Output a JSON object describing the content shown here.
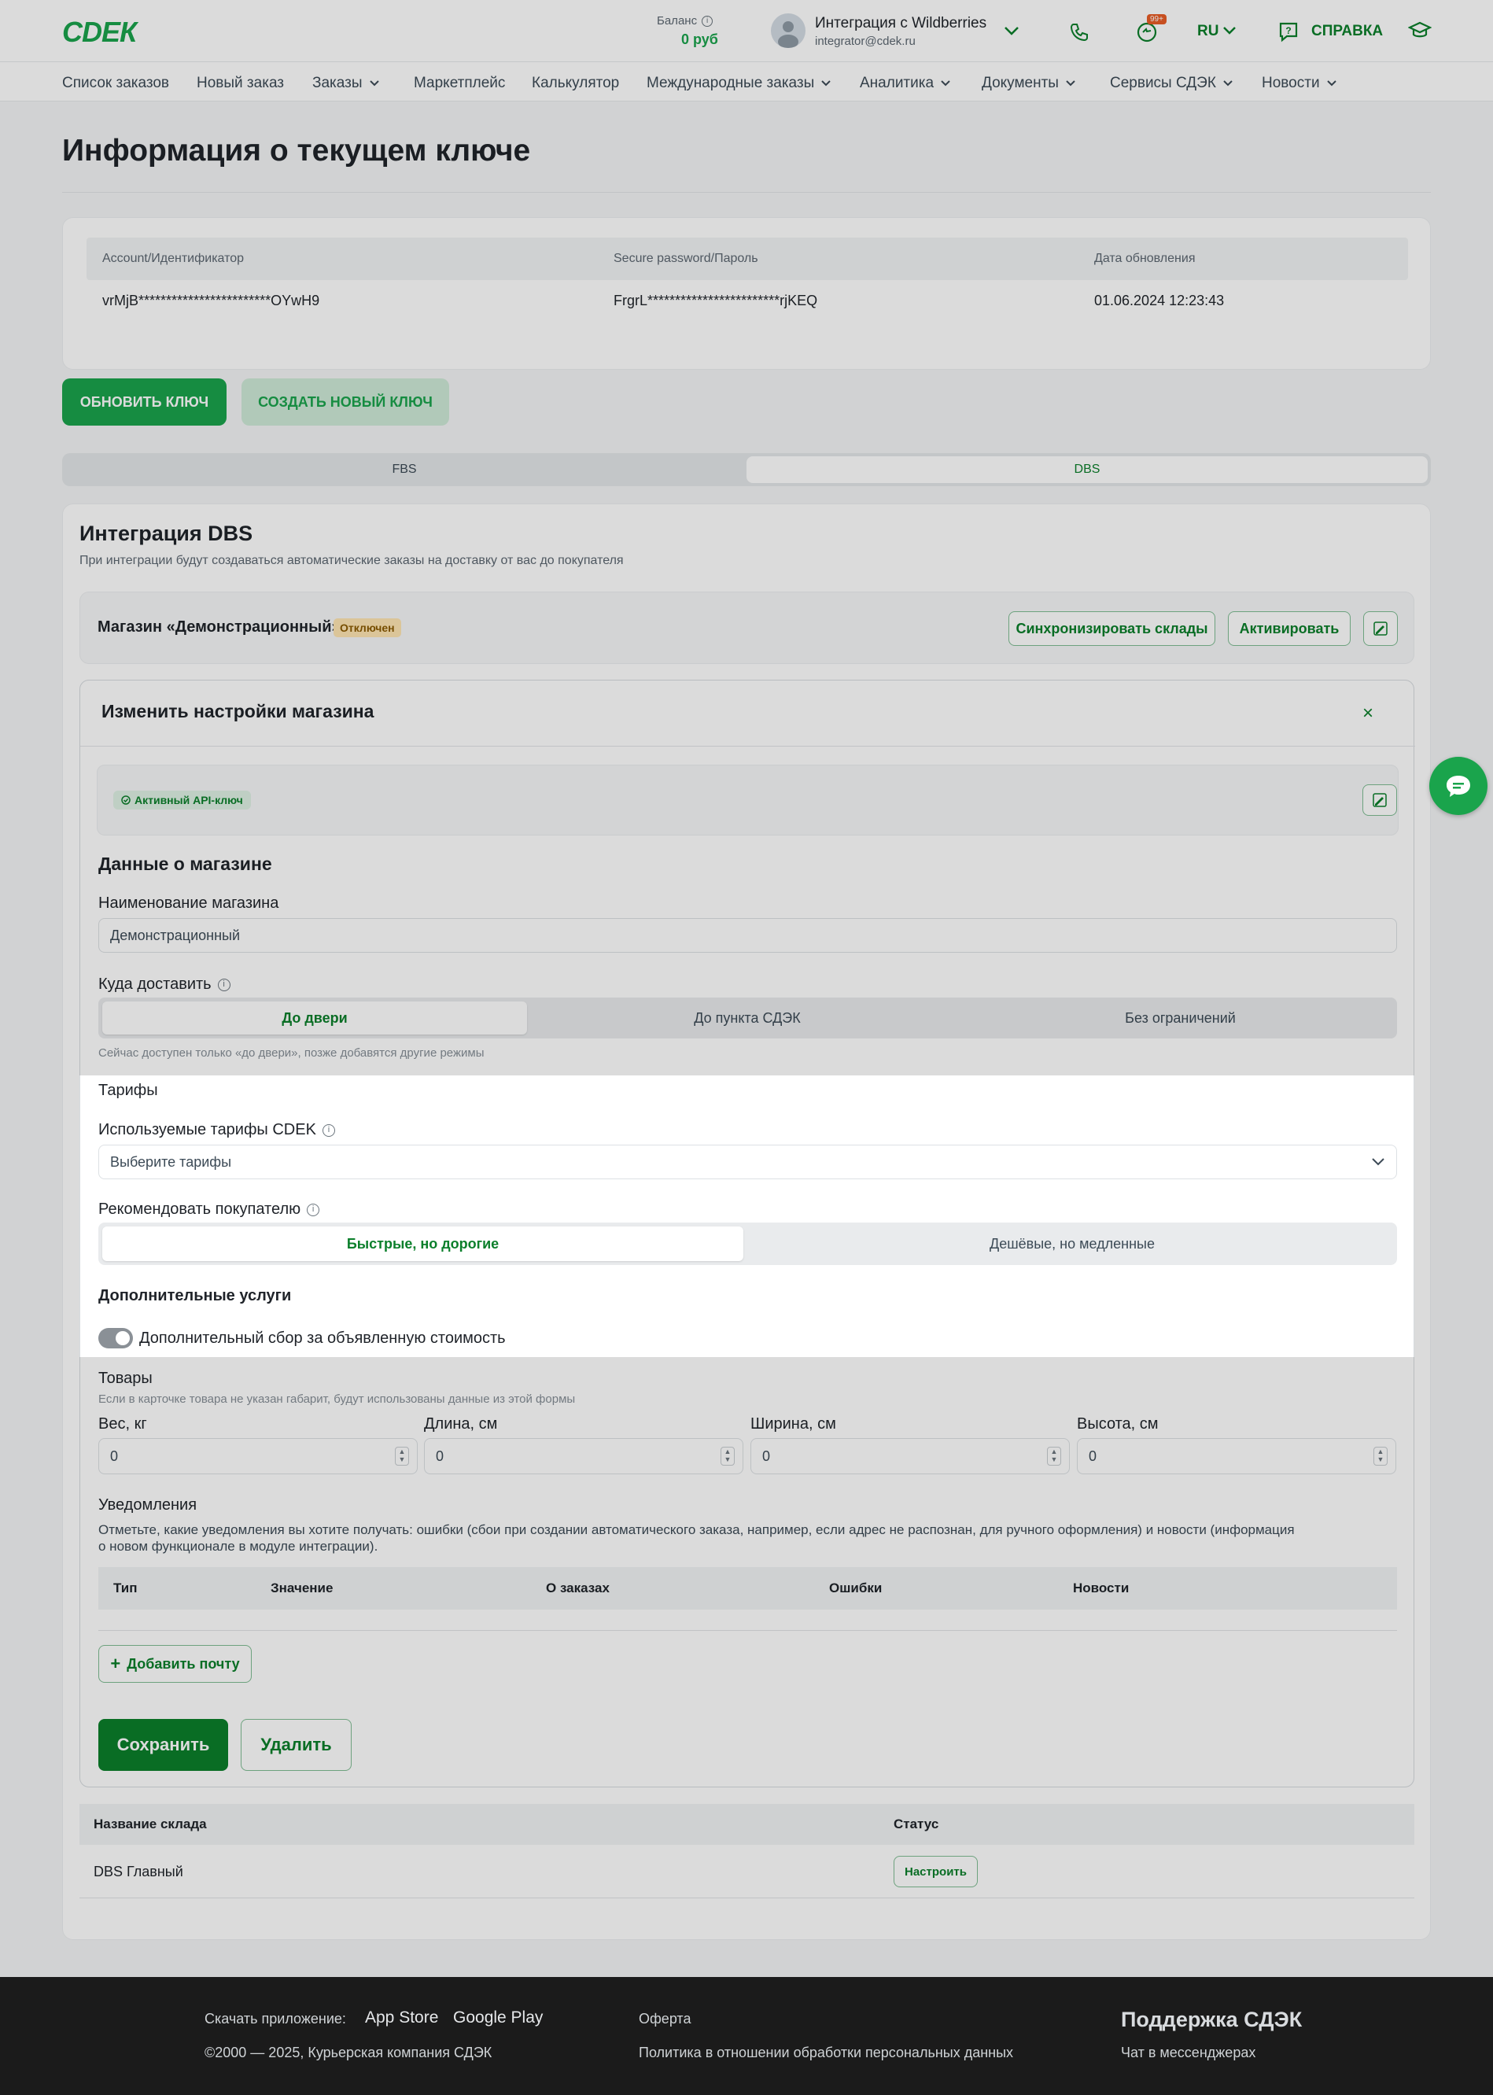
{
  "header": {
    "logo": "СDЕК",
    "balance_label": "Баланс",
    "balance_value": "0 руб",
    "user_name": "Интеграция с Wildberries",
    "user_email": "integrator@cdek.ru",
    "notif_badge": "99+",
    "lang": "RU",
    "help": "СПРАВКА"
  },
  "nav": {
    "items": [
      "Список заказов",
      "Новый заказ",
      "Заказы",
      "Маркетплейс",
      "Калькулятор",
      "Международные заказы",
      "Аналитика",
      "Документы",
      "Сервисы СДЭК",
      "Новости"
    ]
  },
  "page_title": "Информация о текущем ключе",
  "key_table": {
    "headers": [
      "Account/Идентификатор",
      "Secure password/Пароль",
      "Дата обновления"
    ],
    "row": [
      "vrMjB************************OYwH9",
      "FrgrL************************rjKEQ",
      "01.06.2024 12:23:43"
    ]
  },
  "key_buttons": {
    "refresh": "ОБНОВИТЬ КЛЮЧ",
    "create": "СОЗДАТЬ НОВЫЙ КЛЮЧ"
  },
  "tabs": [
    "FBS",
    "DBS"
  ],
  "integration": {
    "title": "Интеграция DBS",
    "subtitle": "При интеграции будут создаваться автоматические заказы на доставку от вас до покупателя"
  },
  "store": {
    "name": "Магазин «Демонстрационный»",
    "status": "Отключен",
    "sync_button": "Синхронизировать склады",
    "activate_button": "Активировать"
  },
  "modal": {
    "title": "Изменить настройки магазина",
    "api_badge": "Активный API-ключ",
    "store_data_title": "Данные о магазине",
    "store_name_label": "Наименование магазина",
    "store_name_value": "Демонстрационный",
    "delivery_label": "Куда доставить",
    "delivery_options": [
      "До двери",
      "До пункта СДЭК",
      "Без ограничений"
    ],
    "delivery_hint": "Сейчас доступен только «до двери», позже добавятся другие режимы",
    "tariffs_title": "Тарифы",
    "tariffs_label": "Используемые тарифы CDEK",
    "tariffs_placeholder": "Выберите тарифы",
    "recommend_label": "Рекомендовать покупателю",
    "recommend_options": [
      "Быстрые, но дорогие",
      "Дешёвые, но медленные"
    ],
    "extra_title": "Дополнительные услуги",
    "extra_toggle": "Дополнительный сбор за объявленную стоимость",
    "goods_title": "Товары",
    "goods_hint": "Если в карточке товара не указан габарит, будут использованы данные из этой формы",
    "dims": [
      {
        "label": "Вес, кг",
        "value": "0"
      },
      {
        "label": "Длина, см",
        "value": "0"
      },
      {
        "label": "Ширина, см",
        "value": "0"
      },
      {
        "label": "Высота, см",
        "value": "0"
      }
    ],
    "notif_title": "Уведомления",
    "notif_desc_1": "Отметьте, какие уведомления вы хотите получать: ошибки (сбои при создании автоматического заказа, например, если адрес не распознан, для ручного оформления) и новости (информация",
    "notif_desc_2": "о новом функционале в модуле интеграции).",
    "notif_headers": [
      "Тип",
      "Значение",
      "О заказах",
      "Ошибки",
      "Новости"
    ],
    "add_email": "Добавить почту",
    "save": "Сохранить",
    "delete": "Удалить"
  },
  "warehouses": {
    "headers": [
      "Название склада",
      "Статус"
    ],
    "rows": [
      {
        "name": "DBS Главный",
        "action": "Настроить"
      }
    ]
  },
  "footer": {
    "download": "Скачать приложение:",
    "app_store": "App Store",
    "google_play": "Google Play",
    "copyright": "©2000 — 2025, Курьерская компания СДЭК",
    "offer": "Оферта",
    "privacy": "Политика в отношении обработки персональных данных",
    "support_title": "Поддержка СДЭК",
    "support_chat": "Чат в мессенджерах"
  }
}
